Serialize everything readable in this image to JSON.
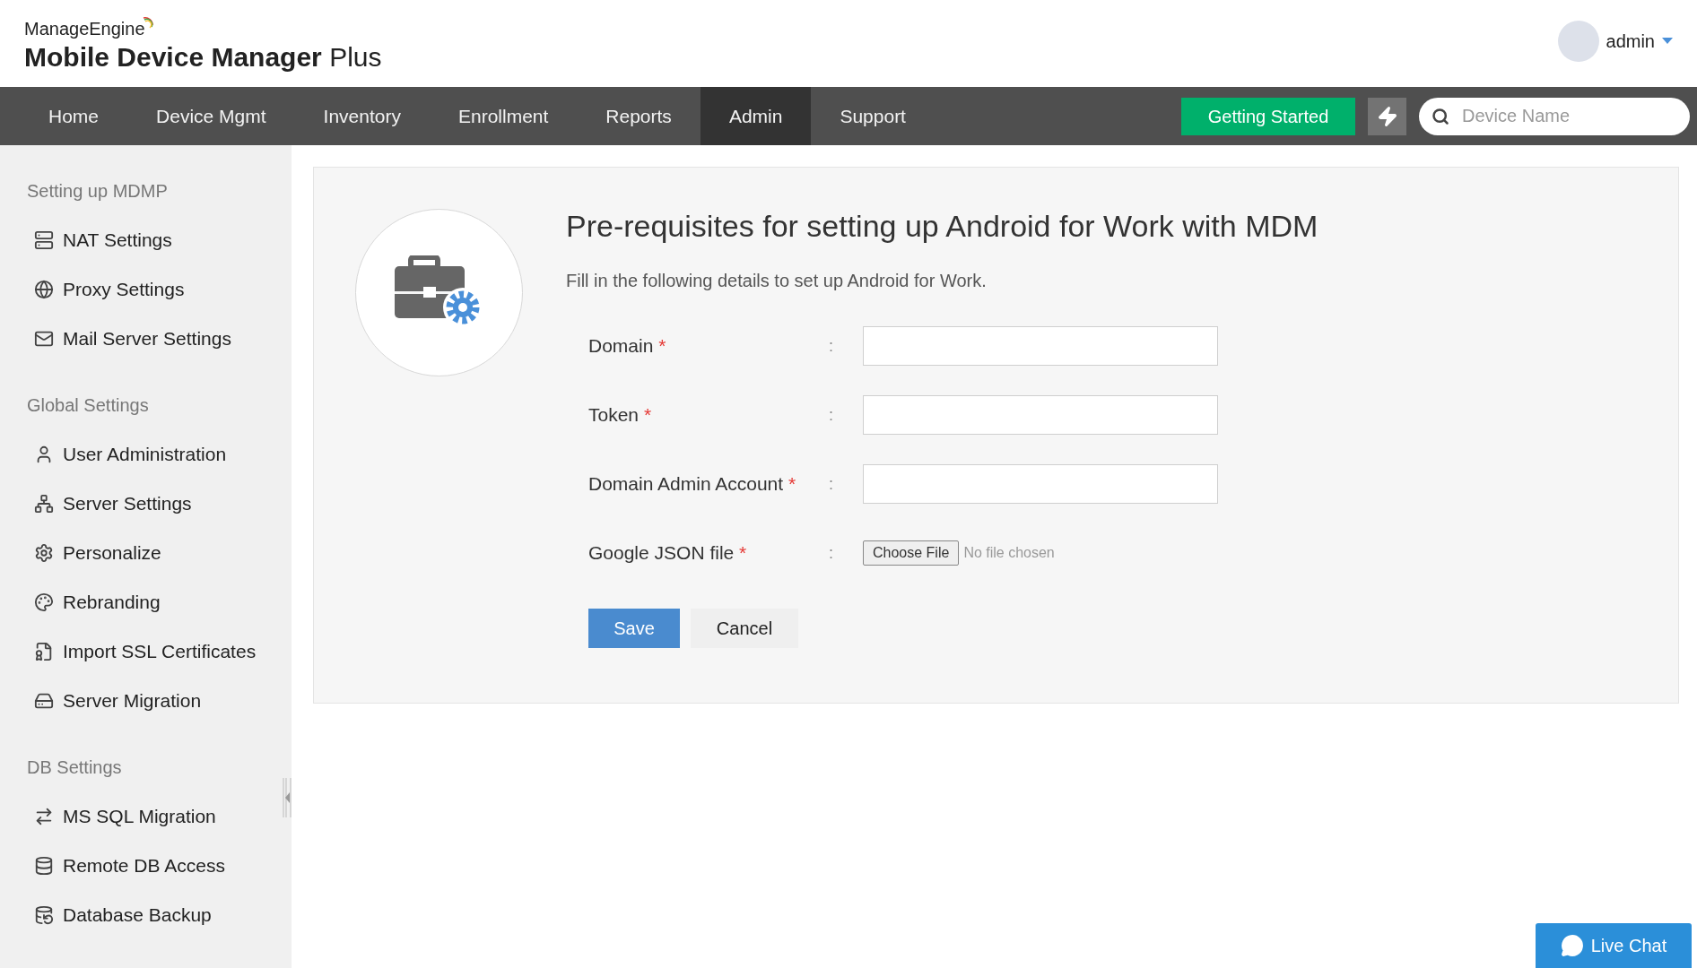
{
  "brand": {
    "company": "ManageEngine",
    "product": "Mobile Device Manager",
    "product_suffix": "Plus"
  },
  "user": {
    "name": "admin"
  },
  "nav": [
    {
      "label": "Home",
      "selected": false
    },
    {
      "label": "Device Mgmt",
      "selected": false
    },
    {
      "label": "Inventory",
      "selected": false
    },
    {
      "label": "Enrollment",
      "selected": false
    },
    {
      "label": "Reports",
      "selected": false
    },
    {
      "label": "Admin",
      "selected": true
    },
    {
      "label": "Support",
      "selected": false
    }
  ],
  "getting_started": "Getting Started",
  "search": {
    "placeholder": "Device Name"
  },
  "sidebar": [
    {
      "heading": "Setting up MDMP",
      "items": [
        "NAT Settings",
        "Proxy Settings",
        "Mail Server Settings"
      ]
    },
    {
      "heading": "Global Settings",
      "items": [
        "User Administration",
        "Server Settings",
        "Personalize",
        "Rebranding",
        "Import SSL Certificates",
        "Server Migration"
      ]
    },
    {
      "heading": "DB Settings",
      "items": [
        "MS SQL Migration",
        "Remote DB Access",
        "Database Backup"
      ]
    }
  ],
  "form": {
    "title": "Pre-requisites for setting up Android for Work with MDM",
    "subtitle": "Fill in the following details to set up Android for Work.",
    "fields": [
      {
        "kind": "text",
        "label": "Domain",
        "required_mark": "*",
        "separator": ":"
      },
      {
        "kind": "text",
        "label": "Token",
        "required_mark": "*",
        "separator": ":"
      },
      {
        "kind": "text",
        "label": "Domain Admin Account",
        "required_mark": "*",
        "separator": ":"
      },
      {
        "kind": "file",
        "label": "Google JSON file",
        "required_mark": "*",
        "separator": ":",
        "button": "Choose File",
        "status": "No file chosen"
      }
    ],
    "save": "Save",
    "cancel": "Cancel"
  },
  "live_chat": "Live Chat"
}
